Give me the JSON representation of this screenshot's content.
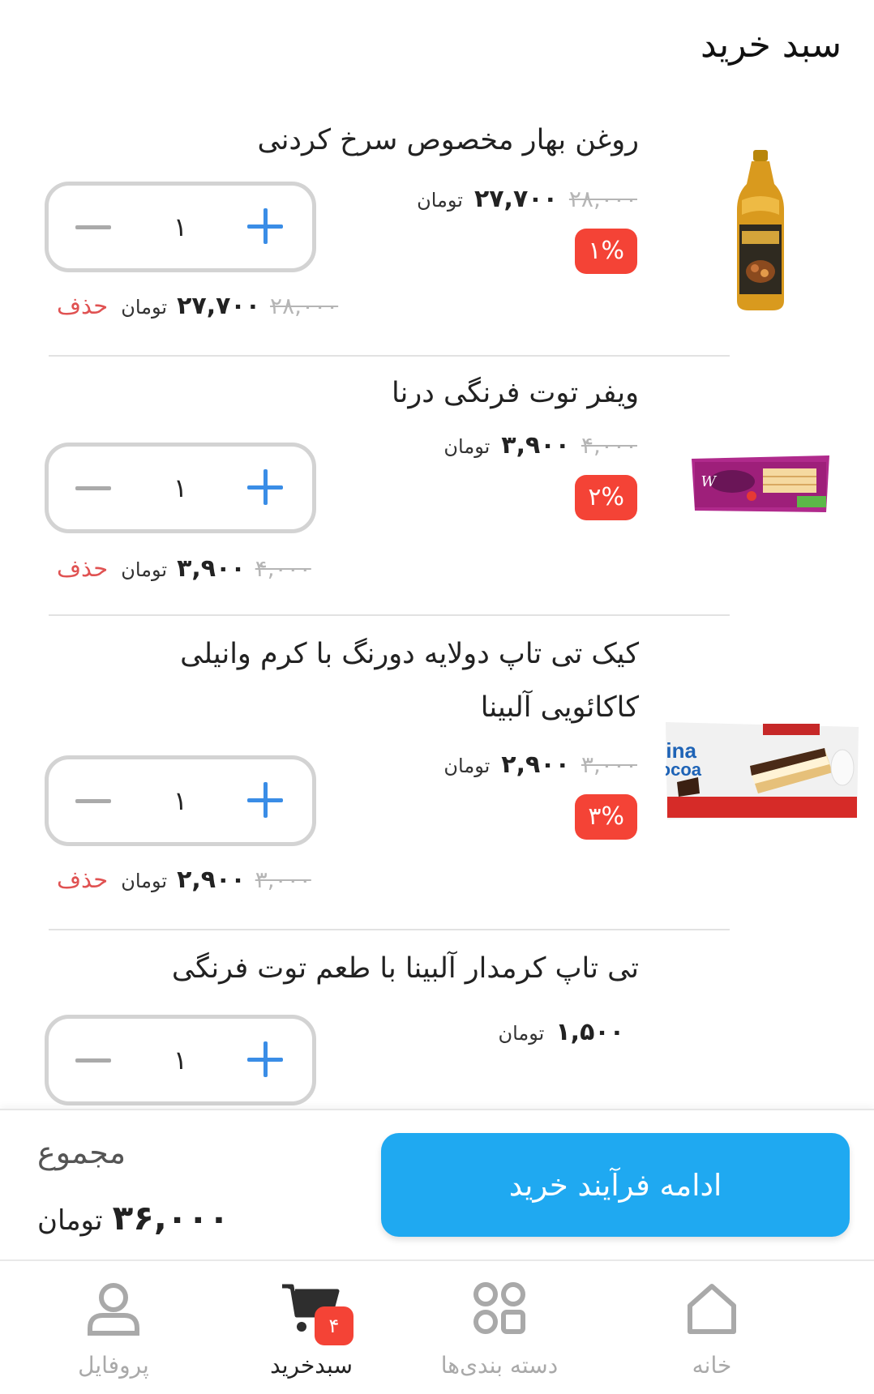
{
  "header": {
    "title": "سبد خرید"
  },
  "items": [
    {
      "name": "روغن بهار مخصوص سرخ کردنی",
      "image": "oil-bottle",
      "old_price": "۲۸,۰۰۰",
      "new_price": "۲۷,۷۰۰",
      "unit": "تومان",
      "discount": "۱%",
      "quantity": "۱",
      "total_old": "۲۸,۰۰۰",
      "total_new": "۲۷,۷۰۰",
      "delete_label": "حذف"
    },
    {
      "name": "ویفر توت فرنگی درنا",
      "image": "wafer-pack",
      "old_price": "۴,۰۰۰",
      "new_price": "۳,۹۰۰",
      "unit": "تومان",
      "discount": "۲%",
      "quantity": "۱",
      "total_old": "۴,۰۰۰",
      "total_new": "۳,۹۰۰",
      "delete_label": "حذف"
    },
    {
      "name": "کیک تی تاپ دولایه دورنگ با کرم وانیلی کاکائویی آلبینا",
      "image": "cake-pack",
      "image_text_1": "Albina",
      "image_text_2": "cocoa",
      "old_price": "۳,۰۰۰",
      "new_price": "۲,۹۰۰",
      "unit": "تومان",
      "discount": "۳%",
      "quantity": "۱",
      "total_old": "۳,۰۰۰",
      "total_new": "۲,۹۰۰",
      "delete_label": "حذف"
    },
    {
      "name": "تی تاپ کرمدار آلبینا با طعم توت فرنگی",
      "new_price": "۱,۵۰۰",
      "unit": "تومان",
      "quantity": "۱"
    }
  ],
  "summary": {
    "label": "مجموع",
    "total": "۳۶,۰۰۰",
    "unit": "تومان",
    "checkout_label": "ادامه فرآیند خرید"
  },
  "nav": {
    "home": "خانه",
    "categories": "دسته بندی‌ها",
    "cart": "سبدخرید",
    "cart_count": "۴",
    "profile": "پروفایل"
  },
  "colors": {
    "primary": "#1fa9f1",
    "plus": "#3a8de6",
    "discount": "#f44336",
    "delete": "#e05252"
  }
}
